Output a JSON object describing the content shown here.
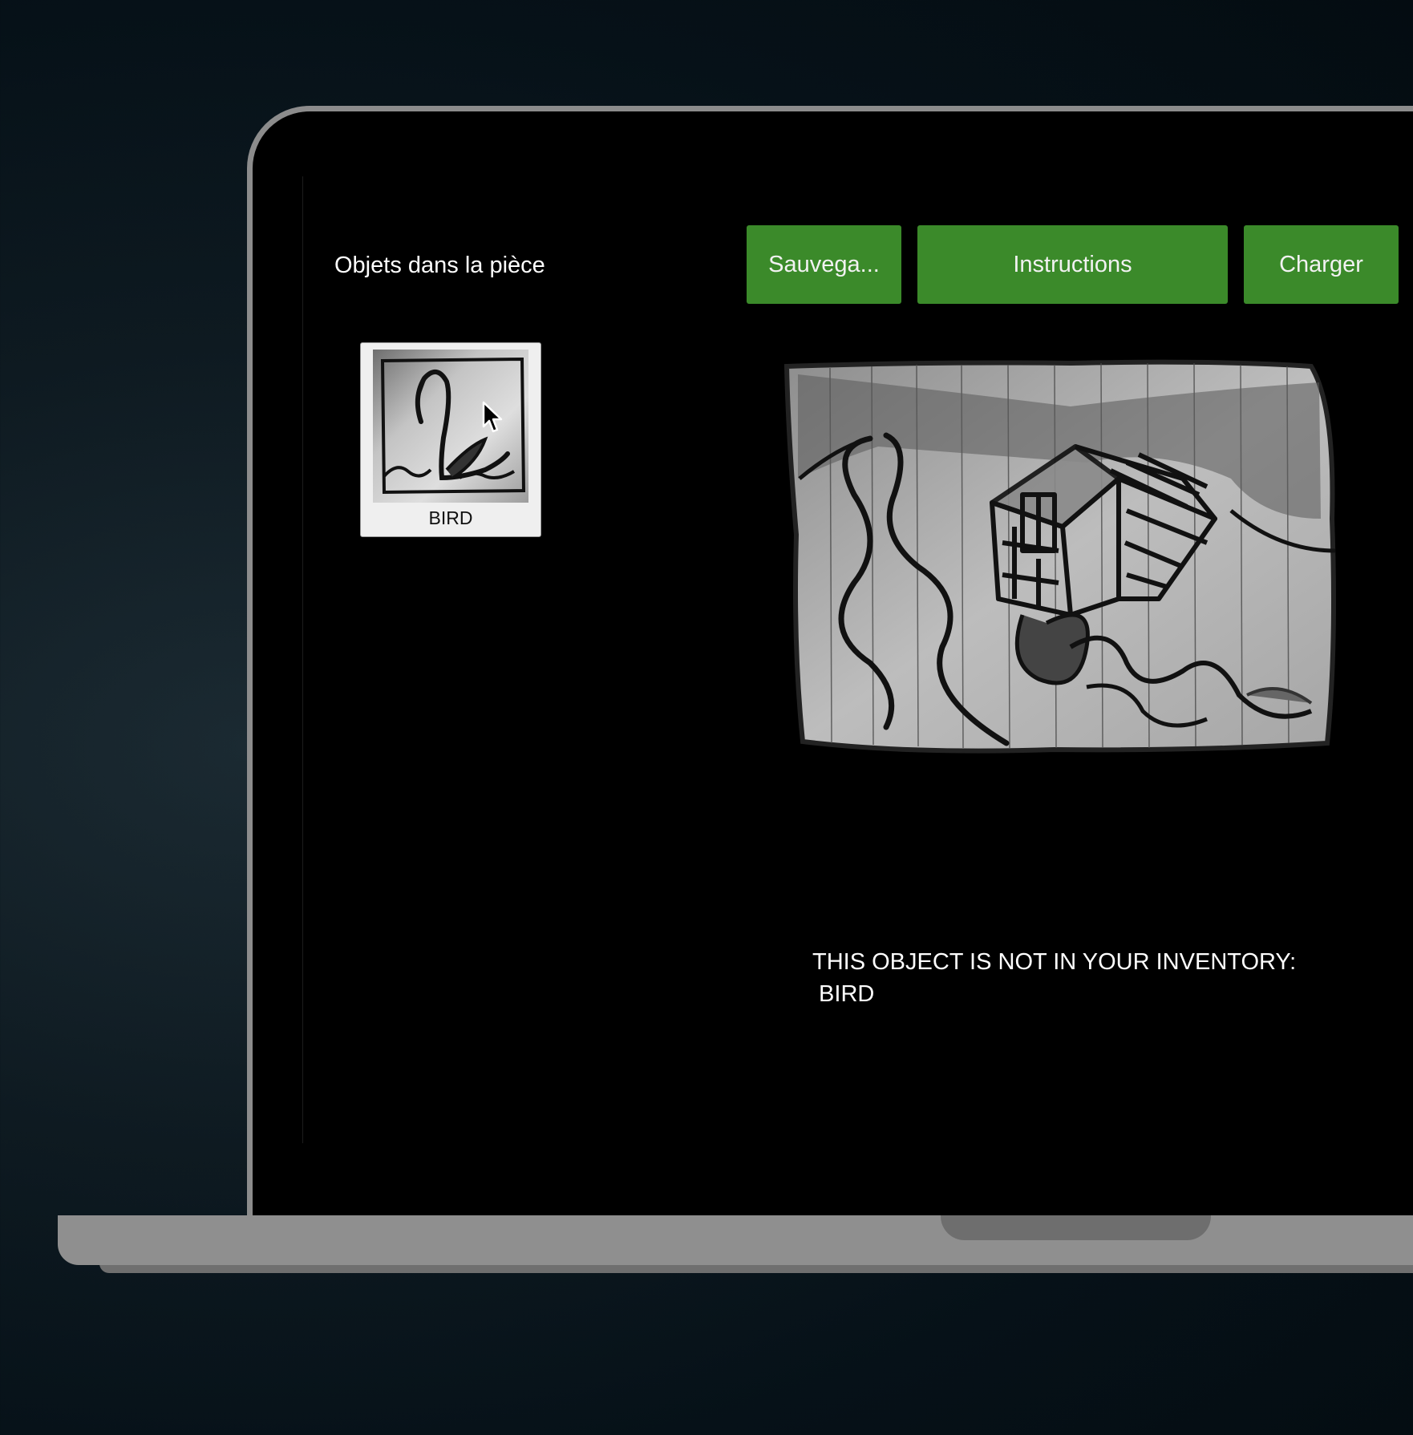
{
  "sidebar": {
    "title": "Objets dans la pièce",
    "objects": [
      {
        "label": "BIRD",
        "icon": "swan-drawing-icon"
      }
    ]
  },
  "toolbar": {
    "save_label": "Sauvega...",
    "instructions_label": "Instructions",
    "load_label": "Charger"
  },
  "main": {
    "picture": "house-river-sketch-icon",
    "message_line1": "THIS OBJECT IS NOT IN YOUR INVENTORY:",
    "message_line2": " BIRD"
  },
  "colors": {
    "button_green": "#3b8a2a",
    "screen_bg": "#000000",
    "frame_grey": "#8c8c8c",
    "backdrop": "#061118"
  }
}
